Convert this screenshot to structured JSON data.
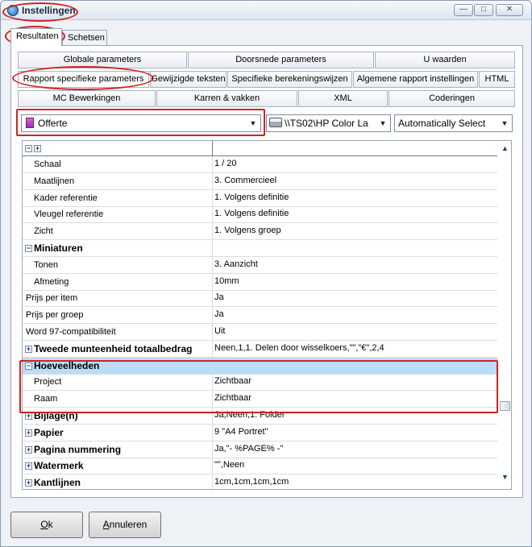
{
  "window": {
    "title": "Instellingen"
  },
  "main_tabs": [
    {
      "label": "Resultaten",
      "active": true
    },
    {
      "label": "Schetsen",
      "active": false
    }
  ],
  "sub_tabs": {
    "row1": [
      "Globale parameters",
      "Doorsnede parameters",
      "U waarden"
    ],
    "row2": [
      "Rapport specifieke parameters",
      "Gewijzigde teksten",
      "Specifieke berekeningswijzen",
      "Algemene rapport instellingen",
      "HTML"
    ],
    "row3": [
      "MC Bewerkingen",
      "Karren & vakken",
      "XML",
      "Coderingen"
    ]
  },
  "selectors": {
    "report": "Offerte",
    "printer": "\\\\TS02\\HP Color La",
    "paper": "Automatically Select"
  },
  "grid": {
    "header_expand": "+",
    "header_collapse": "−",
    "rows": [
      {
        "name": "Schaal",
        "value": "1 / 20"
      },
      {
        "name": "Maatlijnen",
        "value": "3. Commercieel"
      },
      {
        "name": "Kader referentie",
        "value": "1. Volgens definitie"
      },
      {
        "name": "Vleugel referentie",
        "value": "1. Volgens definitie"
      },
      {
        "name": "Zicht",
        "value": "1. Volgens groep"
      },
      {
        "name": "Miniaturen",
        "value": ""
      },
      {
        "name": "Tonen",
        "value": "3. Aanzicht"
      },
      {
        "name": "Afmeting",
        "value": "10mm"
      },
      {
        "name": "Prijs per item",
        "value": "Ja"
      },
      {
        "name": "Prijs per groep",
        "value": "Ja"
      },
      {
        "name": "Word 97-compatibiliteit",
        "value": "Uit"
      },
      {
        "name": "Tweede munteenheid totaalbedrag",
        "value": "Neen,1,1. Delen door wisselkoers,\"\",\"€\",2,4"
      },
      {
        "name": "Hoeveelheden",
        "value": ""
      },
      {
        "name": "Project",
        "value": "Zichtbaar"
      },
      {
        "name": "Raam",
        "value": "Zichtbaar"
      },
      {
        "name": "Bijlage(n)",
        "value": "Ja,Neen,1. Folder"
      },
      {
        "name": "Papier",
        "value": "9 \"A4 Portret\""
      },
      {
        "name": "Pagina nummering",
        "value": "Ja,\"- %PAGE% -\""
      },
      {
        "name": "Watermerk",
        "value": "\"\",Neen"
      },
      {
        "name": "Kantlijnen",
        "value": "1cm,1cm,1cm,1cm"
      }
    ]
  },
  "icons": {
    "scroll_up": "▲",
    "scroll_down": "▼",
    "dropdown": "▼",
    "minimize": "—",
    "maximize": "□",
    "close": "✕"
  },
  "buttons": {
    "ok_access": "O",
    "ok_rest": "k",
    "cancel_access": "A",
    "cancel_rest": "nnuleren"
  },
  "colors": {
    "annotation": "#d42121",
    "selection": "#bcdcf6"
  }
}
